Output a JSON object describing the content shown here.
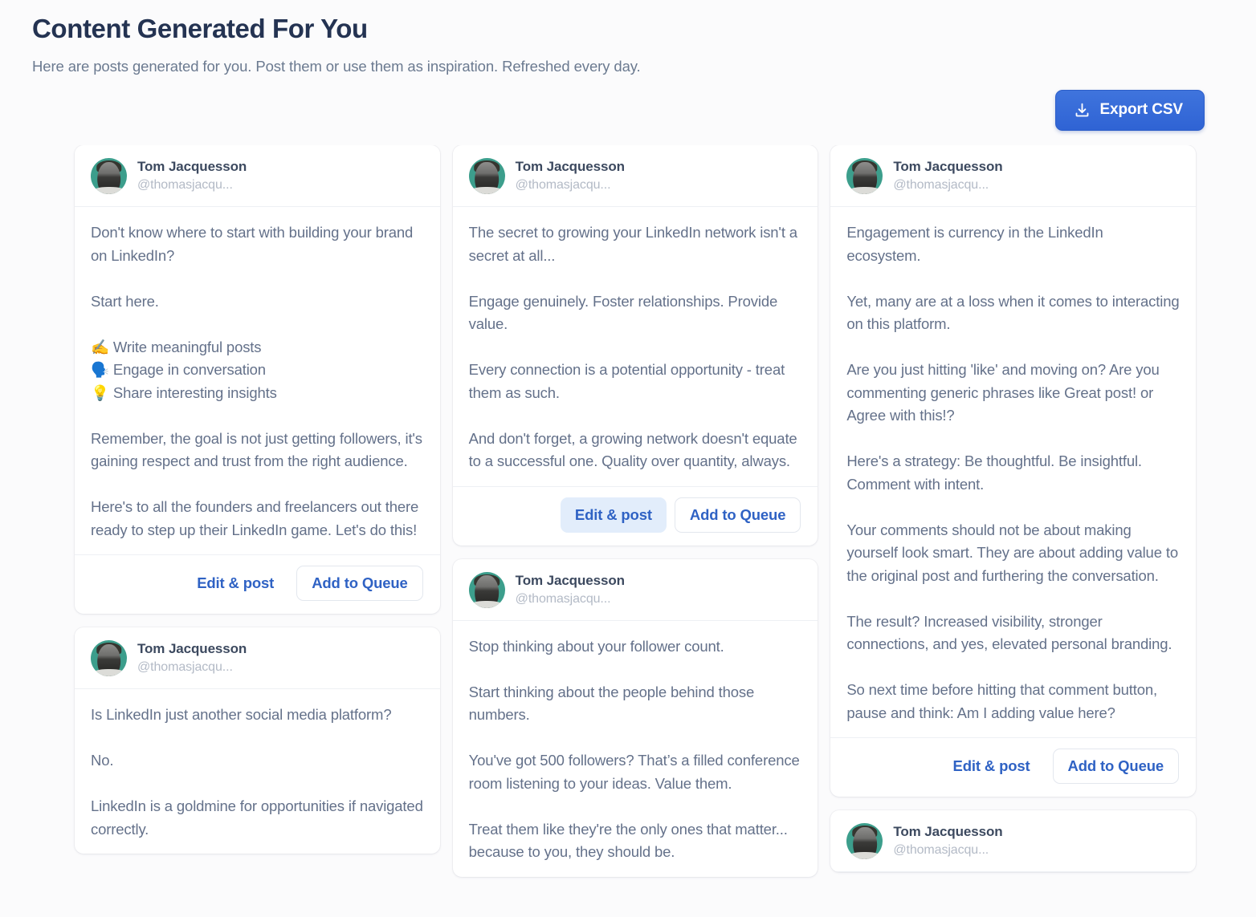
{
  "header": {
    "title": "Content Generated For You",
    "subtitle": "Here are posts generated for you. Post them or use them as inspiration. Refreshed every day."
  },
  "toolbar": {
    "export_label": "Export CSV",
    "export_icon": "download-tray-icon",
    "accent_color": "#3468d6"
  },
  "actions": {
    "edit_label": "Edit & post",
    "queue_label": "Add to Queue"
  },
  "author": {
    "name": "Tom Jacquesson",
    "handle": "@thomasjacqu...",
    "avatar_bg": "#3c9e8c"
  },
  "columns": [
    {
      "cards": [
        {
          "author": "Tom Jacquesson",
          "handle": "@thomasjacqu...",
          "body": "Don't know where to start with building your brand on LinkedIn?\n\nStart here.\n\n✍️ Write meaningful posts\n🗣️ Engage in conversation\n💡 Share interesting insights\n\nRemember, the goal is not just getting followers, it's gaining respect and trust from the right audience.\n\nHere's to all the founders and freelancers out there ready to step up their LinkedIn game. Let's do this!",
          "has_actions": true,
          "edit_active": false
        },
        {
          "author": "Tom Jacquesson",
          "handle": "@thomasjacqu...",
          "body": "Is LinkedIn just another social media platform?\n\nNo.\n\nLinkedIn is a goldmine for opportunities if navigated correctly.",
          "has_actions": false,
          "edit_active": false
        }
      ]
    },
    {
      "cards": [
        {
          "author": "Tom Jacquesson",
          "handle": "@thomasjacqu...",
          "body": "The secret to growing your LinkedIn network isn't a secret at all...\n\nEngage genuinely. Foster relationships. Provide value.\n\nEvery connection is a potential opportunity - treat them as such.\n\nAnd don't forget, a growing network doesn't equate to a successful one. Quality over quantity, always.",
          "has_actions": true,
          "edit_active": true
        },
        {
          "author": "Tom Jacquesson",
          "handle": "@thomasjacqu...",
          "body": "Stop thinking about your follower count.\n\nStart thinking about the people behind those numbers.\n\nYou've got 500 followers? That’s a filled conference room listening to your ideas. Value them.\n\nTreat them like they're the only ones that matter... because to you, they should be.",
          "has_actions": false,
          "edit_active": false
        }
      ]
    },
    {
      "cards": [
        {
          "author": "Tom Jacquesson",
          "handle": "@thomasjacqu...",
          "body": "Engagement is currency in the LinkedIn ecosystem.\n\nYet, many are at a loss when it comes to interacting on this platform.\n\nAre you just hitting 'like' and moving on? Are you commenting generic phrases like Great post! or Agree with this!?\n\nHere's a strategy: Be thoughtful. Be insightful. Comment with intent.\n\nYour comments should not be about making yourself look smart. They are about adding value to the original post and furthering the conversation.\n\nThe result? Increased visibility, stronger connections, and yes, elevated personal branding.\n\nSo next time before hitting that comment button, pause and think: Am I adding value here?",
          "has_actions": true,
          "edit_active": false
        },
        {
          "author": "Tom Jacquesson",
          "handle": "@thomasjacqu...",
          "body": "",
          "has_actions": false,
          "edit_active": false
        }
      ]
    }
  ]
}
